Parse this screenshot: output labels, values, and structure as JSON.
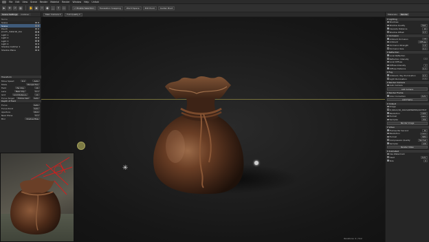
{
  "menubar": {
    "items": [
      "File",
      "Edit",
      "View",
      "Scene",
      "Render",
      "Material",
      "Render",
      "Window",
      "Help",
      "Unfold"
    ]
  },
  "toolbar": {
    "tool_icons": [
      "select-icon",
      "move-icon",
      "rotate-icon",
      "scale-icon",
      "grab-icon",
      "camera-icon",
      "light-icon",
      "sphere-icon",
      "shape-icon",
      "search-icon",
      "target-icon"
    ],
    "toggles": [
      {
        "label": "Enable Selection",
        "on": true
      },
      {
        "label": "Translation Snapping",
        "on": false
      },
      {
        "label": "World Space",
        "on": false
      },
      {
        "label": "Edit Pivot",
        "on": false
      },
      {
        "label": "Center Pivot",
        "on": false
      }
    ]
  },
  "left_panel": {
    "tabs": [
      "Scene Settings",
      "Outliner"
    ],
    "outliner_header": "Name",
    "items": [
      {
        "label": "Scene",
        "selected": false
      },
      {
        "label": "Scene",
        "selected": true
      },
      {
        "label": "Pouch",
        "selected": false
      },
      {
        "label": "pouch_material_low",
        "selected": false
      },
      {
        "label": "Light 1",
        "selected": false
      },
      {
        "label": "Light 2",
        "selected": false
      },
      {
        "label": "Light 3",
        "selected": false
      },
      {
        "label": "Light 4",
        "selected": false
      },
      {
        "label": "Shadow Catcher 1",
        "selected": false
      },
      {
        "label": "Shadow Plane",
        "selected": false
      }
    ],
    "properties": {
      "head1": "Transform",
      "rows": [
        {
          "label": "Move Speed",
          "value": "0.1",
          "extra": "Auto"
        },
        {
          "label": "Mode",
          "value": "Perspective",
          "extra": ""
        },
        {
          "label": "Field",
          "value": "Far Clip",
          "extra": "10"
        },
        {
          "label": "Lens",
          "value": "Near Clip",
          "extra": "0.1"
        },
        {
          "label": "Grid",
          "value": "Grid Distance",
          "extra": "10"
        },
        {
          "label": "Focus Target",
          "value": "Follow Cam",
          "extra": "Auto"
        }
      ],
      "head2": "Depth of Field",
      "rows2": [
        {
          "label": "Focus",
          "value": "Auto"
        },
        {
          "label": "Focus Point",
          "value": "Auto"
        },
        {
          "label": "Aperture",
          "value": "f/4.0"
        },
        {
          "label": "Near Plane",
          "value": "0.1"
        },
        {
          "label": "Blur",
          "value": "Shadow Bias"
        }
      ]
    }
  },
  "viewport": {
    "camera_select": "Main Camera",
    "quality_select": "Full Quality",
    "footer": "Iterations: 0 / 512"
  },
  "right_panel": {
    "tabs": [
      "Materials",
      "Render"
    ],
    "sections": [
      {
        "title": "Lighting",
        "rows": [
          {
            "label": "Shadows",
            "value": ""
          },
          {
            "label": "Shadow Quality",
            "value": "High"
          },
          {
            "label": "Cascade Distance",
            "value": "10"
          },
          {
            "label": "Shadow Offset",
            "value": "0.5"
          }
        ]
      },
      {
        "title": "Occlusion",
        "rows": [
          {
            "label": "Ambient Occlusion",
            "value": "Off"
          },
          {
            "label": "Ambient",
            "value": "Diffuse"
          },
          {
            "label": "Occlusion Strength",
            "value": "1.0"
          },
          {
            "label": "Occlusion Size",
            "value": "0.2"
          }
        ]
      },
      {
        "title": "Reflection",
        "rows": [
          {
            "label": "Local Reflection",
            "value": ""
          },
          {
            "label": "Reflection Intensity",
            "value": "1"
          },
          {
            "label": "Local Diffuse",
            "value": ""
          },
          {
            "label": "Diffuse Intensity",
            "value": "1"
          },
          {
            "label": "Diffuse Distance",
            "value": "0.3"
          }
        ]
      },
      {
        "title": "Fog",
        "rows": [
          {
            "label": "Ambient / Sky Illumination",
            "value": "0.5"
          },
          {
            "label": "Light Illumination",
            "value": "1.0"
          }
        ]
      },
      {
        "title": "Render Camera",
        "rows": [
          {
            "label": "Auto Camera",
            "value": ""
          }
        ],
        "button": "Add Camera"
      },
      {
        "title": "Render Frame",
        "rows": [
          {
            "label": "Color Correction",
            "value": "Auto"
          }
        ],
        "button": "Add Frame"
      },
      {
        "title": "Output",
        "rows": [
          {
            "label": "Image",
            "value": ""
          },
          {
            "label": "D:/Work/3D_DOCS/RENDERS/OUTPUT",
            "value": ""
          },
          {
            "label": "Resolution",
            "value": "1920"
          },
          {
            "label": "Format",
            "value": "JPEG"
          },
          {
            "label": "Samples",
            "value": "256"
          }
        ],
        "button": "Render Image"
      },
      {
        "title": "Video",
        "rows": [
          {
            "label": "Frames Per Second",
            "value": "30"
          },
          {
            "label": "Resolution",
            "value": "1920"
          },
          {
            "label": "Format",
            "value": "MP4"
          },
          {
            "label": "Compression Quality",
            "value": "Normal"
          },
          {
            "label": "Samples",
            "value": "128"
          }
        ],
        "button": "Render Video"
      },
      {
        "title": "Animated",
        "rows": [
          {
            "label": "Use Watermark",
            "value": ""
          },
          {
            "label": "Used",
            "value": "Auto"
          },
          {
            "label": "Size",
            "value": "0"
          }
        ]
      }
    ]
  },
  "colors": {
    "accent": "#3f5a7a",
    "horizon": "#7f7a3e",
    "leather_dark": "#2e1a10",
    "leather_mid": "#5a3420",
    "leather_light": "#8a5a3a",
    "annotation_red": "#d21e1e"
  }
}
